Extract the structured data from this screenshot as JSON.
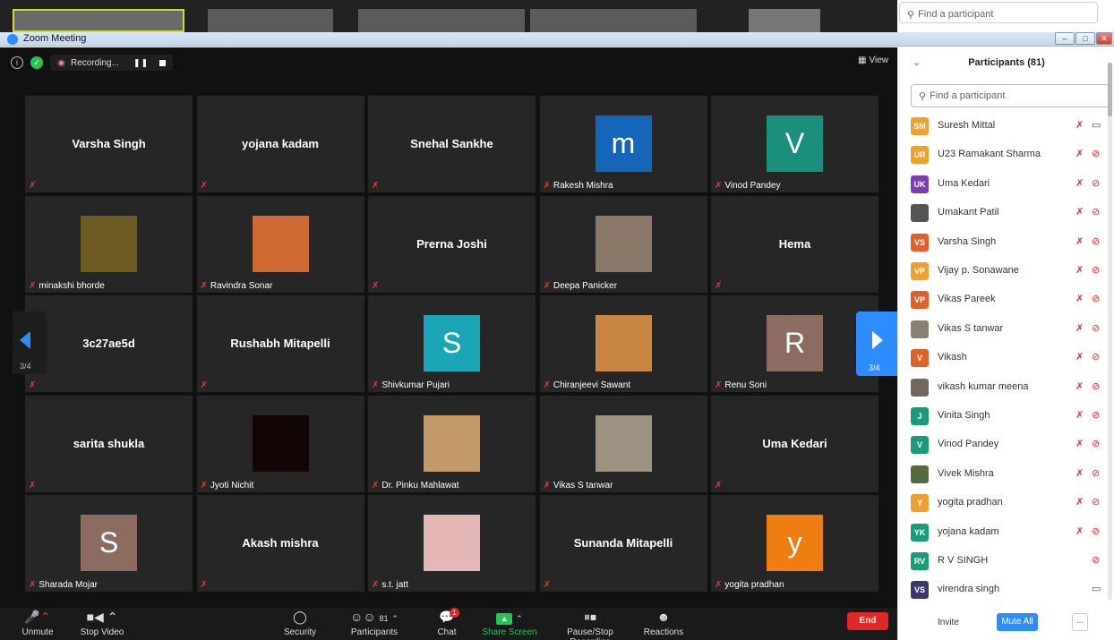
{
  "search_top": {
    "placeholder": "Find a participant"
  },
  "window": {
    "title": "Zoom Meeting"
  },
  "meeting_topbar": {
    "recording": "Recording...",
    "pause_glyph": "❚❚",
    "view": "View"
  },
  "nav": {
    "page": "3/4"
  },
  "tiles": [
    {
      "name": "Varsha Singh",
      "kind": "name"
    },
    {
      "name": "yojana kadam",
      "kind": "name"
    },
    {
      "name": "Snehal Sankhe",
      "kind": "name"
    },
    {
      "name": "Rakesh Mishra",
      "kind": "avatar",
      "letter": "m",
      "color": "#1565b8"
    },
    {
      "name": "Vinod Pandey",
      "kind": "avatar",
      "letter": "V",
      "color": "#1a8f7c"
    },
    {
      "name": "minakshi bhorde",
      "kind": "photo",
      "color": "#6b5a22"
    },
    {
      "name": "Ravindra Sonar",
      "kind": "photo",
      "color": "#cf6a33"
    },
    {
      "name": "Prerna Joshi",
      "kind": "name"
    },
    {
      "name": "Deepa Panicker",
      "kind": "photo",
      "color": "#8a7968"
    },
    {
      "name": "Hema",
      "kind": "name"
    },
    {
      "name": "3c27ae5d",
      "kind": "name"
    },
    {
      "name": "Rushabh Mitapelli",
      "kind": "name"
    },
    {
      "name": "Shivkumar Pujari",
      "kind": "avatar",
      "letter": "S",
      "color": "#1aa6b7"
    },
    {
      "name": "Chiranjeevi Sawant",
      "kind": "photo",
      "color": "#c98643"
    },
    {
      "name": "Renu Soni",
      "kind": "avatar",
      "letter": "R",
      "color": "#8c6b61"
    },
    {
      "name": "sarita shukla",
      "kind": "name"
    },
    {
      "name": "Jyoti Nichit",
      "kind": "photo",
      "color": "#120505"
    },
    {
      "name": "Dr. Pinku Mahlawat",
      "kind": "photo",
      "color": "#c39a67"
    },
    {
      "name": "Vikas S tanwar",
      "kind": "photo",
      "color": "#9e9282"
    },
    {
      "name": "Uma Kedari",
      "kind": "name"
    },
    {
      "name": "Sharada Mojar",
      "kind": "avatar",
      "letter": "S",
      "color": "#8c6b61"
    },
    {
      "name": "Akash mishra",
      "kind": "name"
    },
    {
      "name": "s.t. jatt",
      "kind": "photo",
      "color": "#e3b8b4"
    },
    {
      "name": "Sunanda Mitapelli",
      "kind": "name"
    },
    {
      "name": "yogita pradhan",
      "kind": "avatar",
      "letter": "y",
      "color": "#ee7d12"
    }
  ],
  "toolbar": {
    "unmute": "Unmute",
    "stop_video": "Stop Video",
    "security": "Security",
    "participants": "Participants",
    "participants_count": "81",
    "chat": "Chat",
    "chat_badge": "1",
    "share_screen": "Share Screen",
    "pause_recording": "Pause/Stop Recording",
    "reactions": "Reactions",
    "end": "End"
  },
  "panel": {
    "title": "Participants (81)",
    "search_placeholder": "Find a participant",
    "invite": "Invite",
    "mute_all": "Mute All",
    "more": "..."
  },
  "participants": [
    {
      "initials": "SM",
      "name": "Suresh Mittal",
      "color": "#f0a030",
      "cam_on": true
    },
    {
      "initials": "UR",
      "name": "U23 Ramakant Sharma",
      "color": "#f0a030",
      "cam_on": false
    },
    {
      "initials": "UK",
      "name": "Uma Kedari",
      "color": "#7b3fb0",
      "cam_on": false
    },
    {
      "initials": "",
      "name": "Umakant Patil",
      "color": "#555555",
      "cam_on": false
    },
    {
      "initials": "VS",
      "name": "Varsha Singh",
      "color": "#e0602a",
      "cam_on": false
    },
    {
      "initials": "VP",
      "name": "Vijay p. Sonawane",
      "color": "#f0a030",
      "cam_on": false
    },
    {
      "initials": "VP",
      "name": "Vikas Pareek",
      "color": "#e0602a",
      "cam_on": false
    },
    {
      "initials": "",
      "name": "Vikas S tanwar",
      "color": "#8a8070",
      "cam_on": false
    },
    {
      "initials": "V",
      "name": "Vikash",
      "color": "#e0602a",
      "cam_on": false
    },
    {
      "initials": "",
      "name": "vikash kumar meena",
      "color": "#706860",
      "cam_on": false
    },
    {
      "initials": "J",
      "name": "Vinita Singh",
      "color": "#1a9c7a",
      "cam_on": false
    },
    {
      "initials": "V",
      "name": "Vinod Pandey",
      "color": "#1a9c7a",
      "cam_on": false
    },
    {
      "initials": "",
      "name": "Vivek Mishra",
      "color": "#556a40",
      "cam_on": false
    },
    {
      "initials": "Y",
      "name": "yogita pradhan",
      "color": "#f0a030",
      "cam_on": false
    },
    {
      "initials": "YK",
      "name": "yojana kadam",
      "color": "#1a9c7a",
      "cam_on": false
    },
    {
      "initials": "RV",
      "name": "R V SINGH",
      "color": "#1a9c7a",
      "cam_on": false
    },
    {
      "initials": "VS",
      "name": "virendra singh",
      "color": "#3a3a6a",
      "cam_on": true
    }
  ]
}
